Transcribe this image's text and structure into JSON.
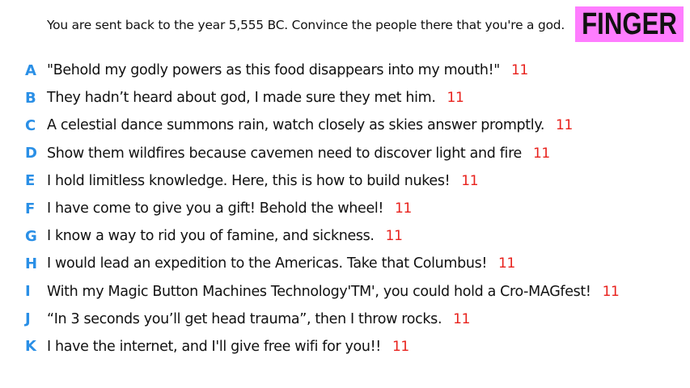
{
  "prompt": "You are sent back to the year 5,555 BC. Convince the people there that you're a god.",
  "player": {
    "name": "FINGER",
    "color": "#ff7dff"
  },
  "colors": {
    "letter": "#2a8fe6",
    "score": "#e8211c"
  },
  "answers": [
    {
      "letter": "A",
      "text": "\"Behold my godly powers as this food disappears into my mouth!\"",
      "score": "11"
    },
    {
      "letter": "B",
      "text": "They hadn’t heard about god, I made sure they met him.",
      "score": "11"
    },
    {
      "letter": "C",
      "text": "A celestial dance summons rain, watch closely as skies answer promptly.",
      "score": "11"
    },
    {
      "letter": "D",
      "text": "Show them wildfires because cavemen need to discover light and fire",
      "score": "11"
    },
    {
      "letter": "E",
      "text": "I hold limitless knowledge. Here, this is how to build nukes!",
      "score": "11"
    },
    {
      "letter": "F",
      "text": "I have come to give you a gift! Behold the wheel!",
      "score": "11"
    },
    {
      "letter": "G",
      "text": "I know a way to rid you of famine, and sickness.",
      "score": "11"
    },
    {
      "letter": "H",
      "text": "I would lead an expedition to the Americas. Take that Columbus!",
      "score": "11"
    },
    {
      "letter": "I",
      "text": "With my Magic Button Machines Technology'TM', you could hold a Cro-MAGfest!",
      "score": "11"
    },
    {
      "letter": "J",
      "text": "“In 3 seconds you’ll get head trauma”, then I throw rocks.",
      "score": "11"
    },
    {
      "letter": "K",
      "text": "I have the internet, and I'll give free wifi for you!!",
      "score": "11"
    }
  ]
}
